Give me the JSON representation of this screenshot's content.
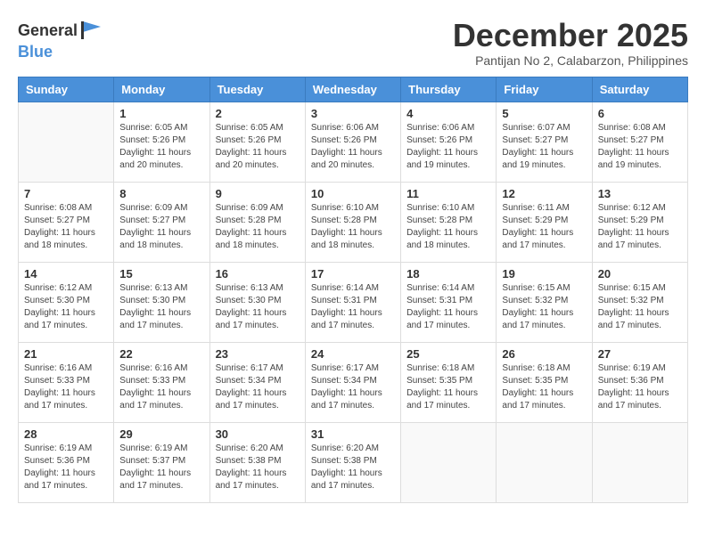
{
  "header": {
    "logo_general": "General",
    "logo_blue": "Blue",
    "month_title": "December 2025",
    "subtitle": "Pantijan No 2, Calabarzon, Philippines"
  },
  "weekdays": [
    "Sunday",
    "Monday",
    "Tuesday",
    "Wednesday",
    "Thursday",
    "Friday",
    "Saturday"
  ],
  "weeks": [
    [
      {
        "day": "",
        "info": ""
      },
      {
        "day": "1",
        "info": "Sunrise: 6:05 AM\nSunset: 5:26 PM\nDaylight: 11 hours\nand 20 minutes."
      },
      {
        "day": "2",
        "info": "Sunrise: 6:05 AM\nSunset: 5:26 PM\nDaylight: 11 hours\nand 20 minutes."
      },
      {
        "day": "3",
        "info": "Sunrise: 6:06 AM\nSunset: 5:26 PM\nDaylight: 11 hours\nand 20 minutes."
      },
      {
        "day": "4",
        "info": "Sunrise: 6:06 AM\nSunset: 5:26 PM\nDaylight: 11 hours\nand 19 minutes."
      },
      {
        "day": "5",
        "info": "Sunrise: 6:07 AM\nSunset: 5:27 PM\nDaylight: 11 hours\nand 19 minutes."
      },
      {
        "day": "6",
        "info": "Sunrise: 6:08 AM\nSunset: 5:27 PM\nDaylight: 11 hours\nand 19 minutes."
      }
    ],
    [
      {
        "day": "7",
        "info": "Sunrise: 6:08 AM\nSunset: 5:27 PM\nDaylight: 11 hours\nand 18 minutes."
      },
      {
        "day": "8",
        "info": "Sunrise: 6:09 AM\nSunset: 5:27 PM\nDaylight: 11 hours\nand 18 minutes."
      },
      {
        "day": "9",
        "info": "Sunrise: 6:09 AM\nSunset: 5:28 PM\nDaylight: 11 hours\nand 18 minutes."
      },
      {
        "day": "10",
        "info": "Sunrise: 6:10 AM\nSunset: 5:28 PM\nDaylight: 11 hours\nand 18 minutes."
      },
      {
        "day": "11",
        "info": "Sunrise: 6:10 AM\nSunset: 5:28 PM\nDaylight: 11 hours\nand 18 minutes."
      },
      {
        "day": "12",
        "info": "Sunrise: 6:11 AM\nSunset: 5:29 PM\nDaylight: 11 hours\nand 17 minutes."
      },
      {
        "day": "13",
        "info": "Sunrise: 6:12 AM\nSunset: 5:29 PM\nDaylight: 11 hours\nand 17 minutes."
      }
    ],
    [
      {
        "day": "14",
        "info": "Sunrise: 6:12 AM\nSunset: 5:30 PM\nDaylight: 11 hours\nand 17 minutes."
      },
      {
        "day": "15",
        "info": "Sunrise: 6:13 AM\nSunset: 5:30 PM\nDaylight: 11 hours\nand 17 minutes."
      },
      {
        "day": "16",
        "info": "Sunrise: 6:13 AM\nSunset: 5:30 PM\nDaylight: 11 hours\nand 17 minutes."
      },
      {
        "day": "17",
        "info": "Sunrise: 6:14 AM\nSunset: 5:31 PM\nDaylight: 11 hours\nand 17 minutes."
      },
      {
        "day": "18",
        "info": "Sunrise: 6:14 AM\nSunset: 5:31 PM\nDaylight: 11 hours\nand 17 minutes."
      },
      {
        "day": "19",
        "info": "Sunrise: 6:15 AM\nSunset: 5:32 PM\nDaylight: 11 hours\nand 17 minutes."
      },
      {
        "day": "20",
        "info": "Sunrise: 6:15 AM\nSunset: 5:32 PM\nDaylight: 11 hours\nand 17 minutes."
      }
    ],
    [
      {
        "day": "21",
        "info": "Sunrise: 6:16 AM\nSunset: 5:33 PM\nDaylight: 11 hours\nand 17 minutes."
      },
      {
        "day": "22",
        "info": "Sunrise: 6:16 AM\nSunset: 5:33 PM\nDaylight: 11 hours\nand 17 minutes."
      },
      {
        "day": "23",
        "info": "Sunrise: 6:17 AM\nSunset: 5:34 PM\nDaylight: 11 hours\nand 17 minutes."
      },
      {
        "day": "24",
        "info": "Sunrise: 6:17 AM\nSunset: 5:34 PM\nDaylight: 11 hours\nand 17 minutes."
      },
      {
        "day": "25",
        "info": "Sunrise: 6:18 AM\nSunset: 5:35 PM\nDaylight: 11 hours\nand 17 minutes."
      },
      {
        "day": "26",
        "info": "Sunrise: 6:18 AM\nSunset: 5:35 PM\nDaylight: 11 hours\nand 17 minutes."
      },
      {
        "day": "27",
        "info": "Sunrise: 6:19 AM\nSunset: 5:36 PM\nDaylight: 11 hours\nand 17 minutes."
      }
    ],
    [
      {
        "day": "28",
        "info": "Sunrise: 6:19 AM\nSunset: 5:36 PM\nDaylight: 11 hours\nand 17 minutes."
      },
      {
        "day": "29",
        "info": "Sunrise: 6:19 AM\nSunset: 5:37 PM\nDaylight: 11 hours\nand 17 minutes."
      },
      {
        "day": "30",
        "info": "Sunrise: 6:20 AM\nSunset: 5:38 PM\nDaylight: 11 hours\nand 17 minutes."
      },
      {
        "day": "31",
        "info": "Sunrise: 6:20 AM\nSunset: 5:38 PM\nDaylight: 11 hours\nand 17 minutes."
      },
      {
        "day": "",
        "info": ""
      },
      {
        "day": "",
        "info": ""
      },
      {
        "day": "",
        "info": ""
      }
    ]
  ]
}
